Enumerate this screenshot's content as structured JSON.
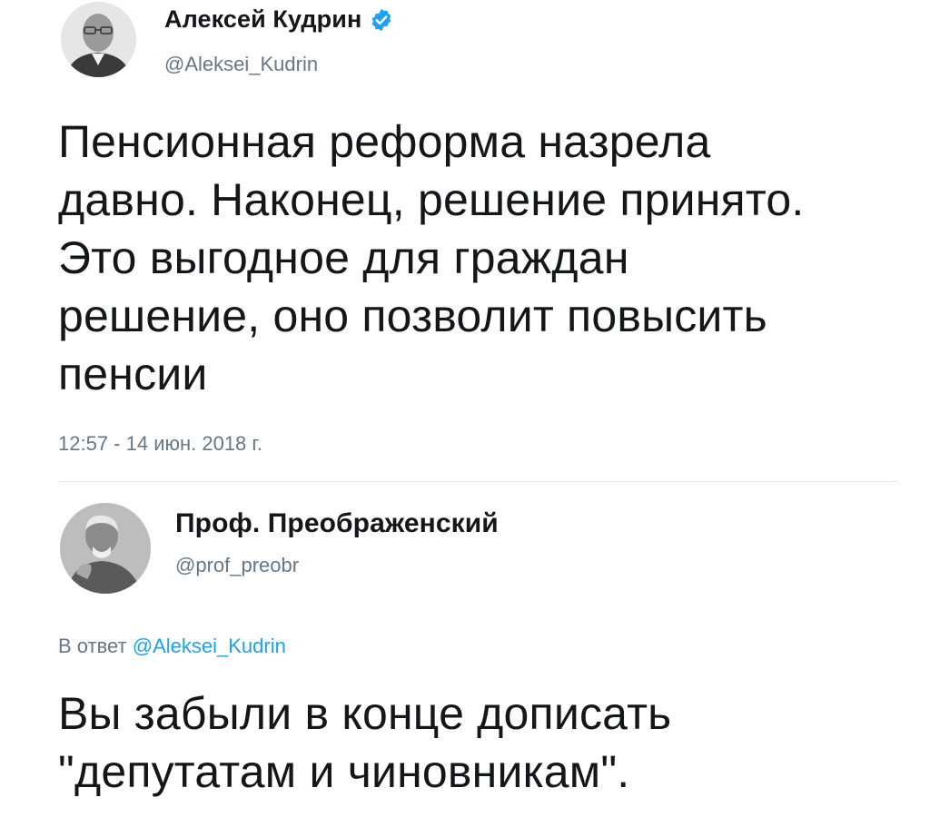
{
  "tweets": [
    {
      "author": {
        "display_name": "Алексей Кудрин",
        "handle": "@Aleksei_Kudrin",
        "verified": true,
        "avatar_icon": "avatar-photo"
      },
      "text_lines": [
        "Пенсионная реформа назрела",
        "давно. Наконец, решение принято.",
        "Это выгодное для граждан",
        "решение, оно позволит повысить",
        "пенсии"
      ],
      "timestamp": "12:57 - 14 июн. 2018 г."
    },
    {
      "author": {
        "display_name": "Проф. Преображенский",
        "handle": "@prof_preobr",
        "verified": false,
        "avatar_icon": "avatar-photo"
      },
      "reply_to": {
        "prefix": "В ответ",
        "mention": "@Aleksei_Kudrin"
      },
      "text_lines": [
        "Вы забыли в конце дописать",
        "\"депутатам и чиновникам\"."
      ]
    }
  ],
  "colors": {
    "text_primary": "#14171a",
    "text_secondary": "#657786",
    "link": "#1da1f2",
    "verified_badge": "#1da1f2",
    "divider": "#e1e8ed"
  }
}
